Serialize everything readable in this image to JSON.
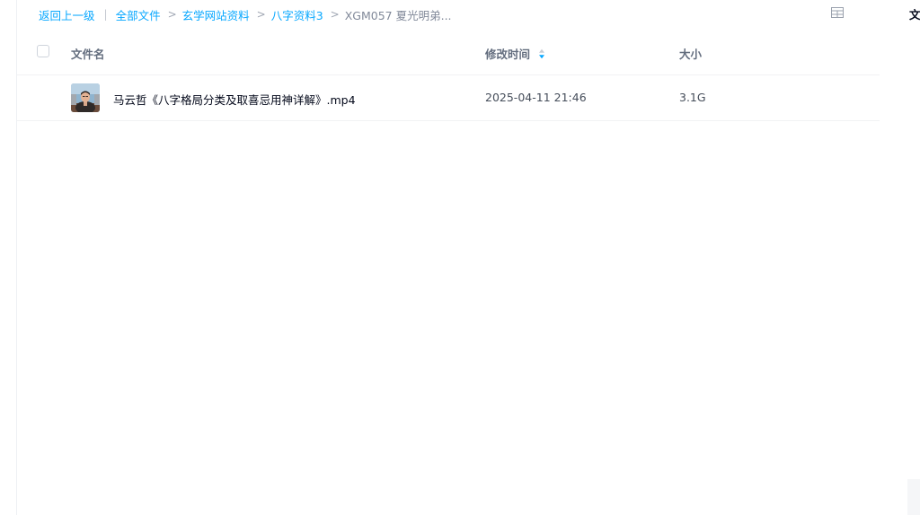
{
  "breadcrumb": {
    "back_label": "返回上一级",
    "bar": "|",
    "sep": ">",
    "items": [
      "全部文件",
      "玄学网站资料",
      "八字资料3"
    ],
    "current": "XGM057 夏光明弟..."
  },
  "list": {
    "columns": {
      "name": "文件名",
      "modified": "修改时间",
      "size": "大小"
    },
    "rows": [
      {
        "name": "马云哲《八字格局分类及取喜忌用神详解》.mp4",
        "modified": "2025-04-11 21:46",
        "size": "3.1G",
        "thumb_icon": "video-thumbnail"
      }
    ]
  },
  "right_panel": {
    "title": "文件"
  },
  "colors": {
    "accent": "#06a7ff",
    "text_primary": "#03081a",
    "text_secondary": "#636d7e",
    "divider": "#f1f2f4"
  }
}
